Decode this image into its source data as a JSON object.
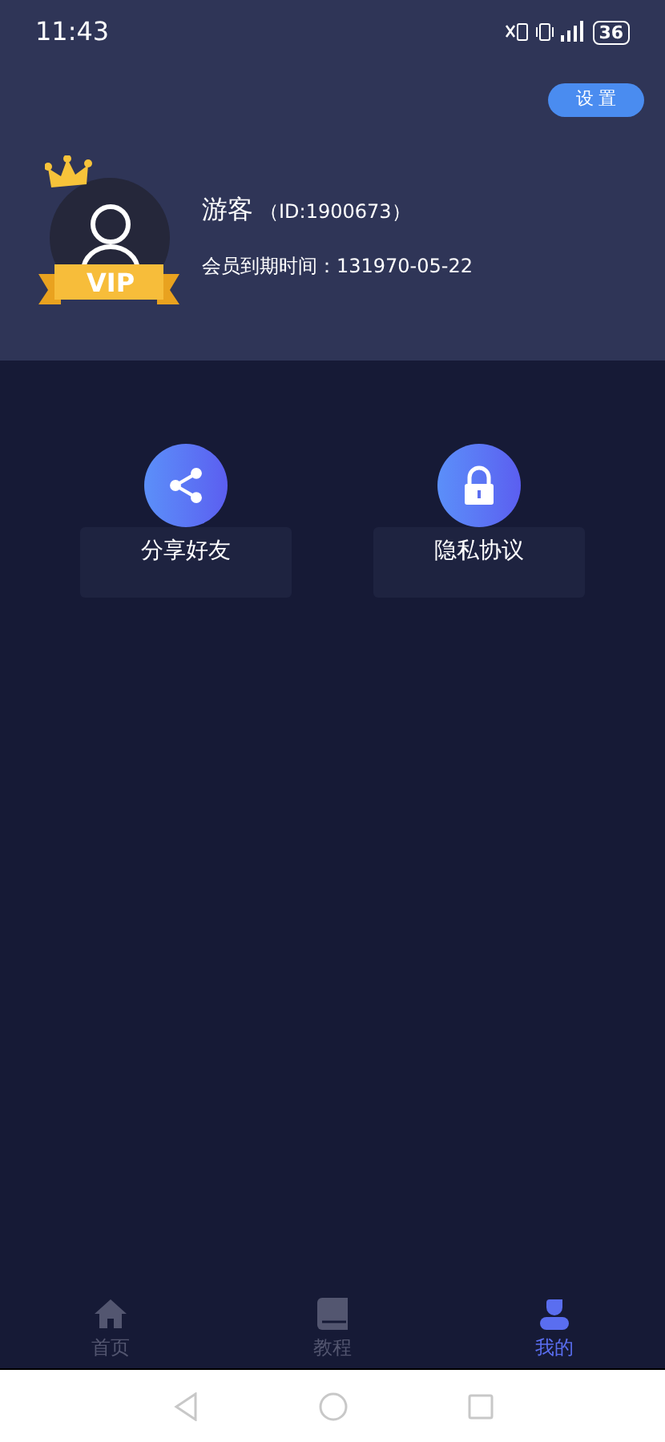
{
  "status_bar": {
    "time": "11:43",
    "battery": "36"
  },
  "settings_button": "设 置",
  "profile": {
    "name": "游客",
    "id": "（ID:1900673）",
    "badge": "VIP",
    "expiry": "会员到期时间：131970-05-22"
  },
  "actions": [
    {
      "kind": "share",
      "label": "分享好友"
    },
    {
      "kind": "lock",
      "label": "隐私协议"
    }
  ],
  "tabs": [
    {
      "kind": "home",
      "label": "首页",
      "selected": false
    },
    {
      "kind": "book",
      "label": "教程",
      "selected": false
    },
    {
      "kind": "user",
      "label": "我的",
      "selected": true
    }
  ]
}
